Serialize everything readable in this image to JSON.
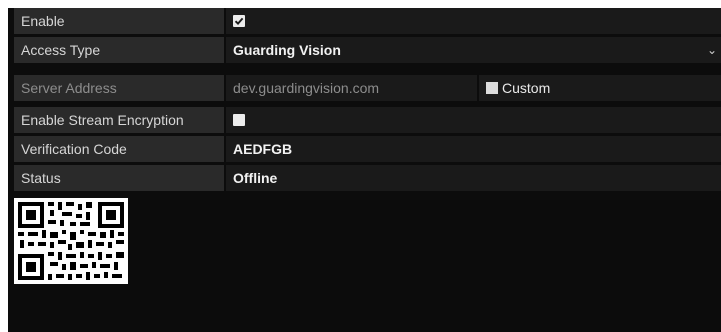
{
  "rows": {
    "enable": {
      "label": "Enable",
      "checked": true
    },
    "access_type": {
      "label": "Access Type",
      "value": "Guarding Vision"
    },
    "server_address": {
      "label": "Server Address",
      "value": "dev.guardingvision.com",
      "custom_label": "Custom"
    },
    "stream_encryption": {
      "label": "Enable Stream Encryption",
      "checked": false
    },
    "verification_code": {
      "label": "Verification Code",
      "value": "AEDFGB"
    },
    "status": {
      "label": "Status",
      "value": "Offline"
    }
  },
  "colors": {
    "panel_bg": "#0c0c0c",
    "label_bg": "#2a2a2a",
    "value_bg": "#1a1a1a",
    "text": "#f2f2f2",
    "dim_text": "#8d8d8d"
  },
  "icons": [
    "check-icon",
    "chevron-down-icon",
    "qr-code-icon"
  ]
}
